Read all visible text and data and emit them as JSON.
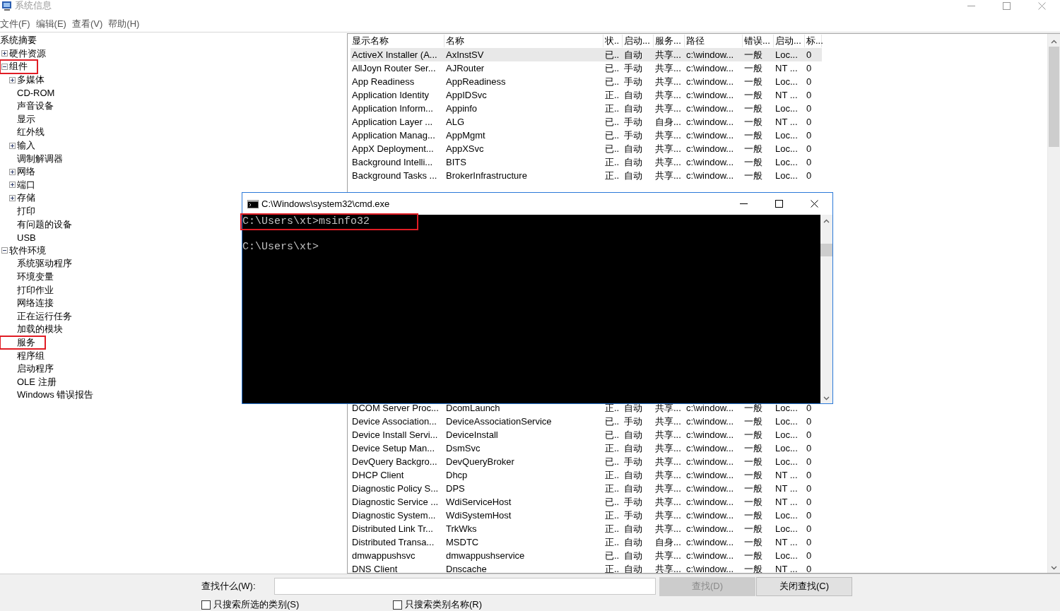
{
  "window": {
    "title": "系统信息"
  },
  "menu": [
    {
      "label": "文件(F)"
    },
    {
      "label": "编辑(E)"
    },
    {
      "label": "查看(V)"
    },
    {
      "label": "帮助(H)"
    }
  ],
  "tree": [
    {
      "label": "系统摘要",
      "highlighted": false,
      "children": [
        {
          "label": "硬件资源",
          "expanded": false,
          "highlighted": false
        },
        {
          "label": "组件",
          "expanded": true,
          "highlighted": true,
          "children": [
            {
              "label": "多媒体",
              "expanded": false,
              "highlighted": false
            },
            {
              "label": "CD-ROM",
              "highlighted": false
            },
            {
              "label": "声音设备",
              "highlighted": false
            },
            {
              "label": "显示",
              "highlighted": false
            },
            {
              "label": "红外线",
              "highlighted": false
            },
            {
              "label": "输入",
              "expanded": false,
              "highlighted": false
            },
            {
              "label": "调制解调器",
              "highlighted": false
            },
            {
              "label": "网络",
              "expanded": false,
              "highlighted": false
            },
            {
              "label": "端口",
              "expanded": false,
              "highlighted": false
            },
            {
              "label": "存储",
              "expanded": false,
              "highlighted": false
            },
            {
              "label": "打印",
              "highlighted": false
            },
            {
              "label": "有问题的设备",
              "highlighted": false
            },
            {
              "label": "USB",
              "highlighted": false
            }
          ]
        },
        {
          "label": "软件环境",
          "expanded": true,
          "highlighted": false,
          "children": [
            {
              "label": "系统驱动程序",
              "highlighted": false
            },
            {
              "label": "环境变量",
              "highlighted": false
            },
            {
              "label": "打印作业",
              "highlighted": false
            },
            {
              "label": "网络连接",
              "highlighted": false
            },
            {
              "label": "正在运行任务",
              "highlighted": false
            },
            {
              "label": "加载的模块",
              "highlighted": false
            },
            {
              "label": "服务",
              "highlighted": true
            },
            {
              "label": "程序组",
              "highlighted": false
            },
            {
              "label": "启动程序",
              "highlighted": false
            },
            {
              "label": "OLE 注册",
              "highlighted": false
            },
            {
              "label": "Windows 错误报告",
              "highlighted": false
            }
          ]
        }
      ]
    }
  ],
  "table": {
    "columns": [
      "显示名称",
      "名称",
      "状..",
      "启动...",
      "服务...",
      "路径",
      "错误...",
      "启动...",
      "标..."
    ],
    "rows": [
      {
        "selected": true,
        "cells": [
          "ActiveX Installer (A...",
          "AxInstSV",
          "已..",
          "自动",
          "共享...",
          "c:\\window...",
          "一般",
          "Loc...",
          "0"
        ]
      },
      {
        "selected": false,
        "cells": [
          "AllJoyn Router Ser...",
          "AJRouter",
          "已..",
          "手动",
          "共享...",
          "c:\\window...",
          "一般",
          "NT ...",
          "0"
        ]
      },
      {
        "selected": false,
        "cells": [
          "App Readiness",
          "AppReadiness",
          "已..",
          "手动",
          "共享...",
          "c:\\window...",
          "一般",
          "Loc...",
          "0"
        ]
      },
      {
        "selected": false,
        "cells": [
          "Application Identity",
          "AppIDSvc",
          "正..",
          "自动",
          "共享...",
          "c:\\window...",
          "一般",
          "NT ...",
          "0"
        ]
      },
      {
        "selected": false,
        "cells": [
          "Application Inform...",
          "Appinfo",
          "正..",
          "自动",
          "共享...",
          "c:\\window...",
          "一般",
          "Loc...",
          "0"
        ]
      },
      {
        "selected": false,
        "cells": [
          "Application Layer ...",
          "ALG",
          "已..",
          "手动",
          "自身...",
          "c:\\window...",
          "一般",
          "NT ...",
          "0"
        ]
      },
      {
        "selected": false,
        "cells": [
          "Application Manag...",
          "AppMgmt",
          "已..",
          "手动",
          "共享...",
          "c:\\window...",
          "一般",
          "Loc...",
          "0"
        ]
      },
      {
        "selected": false,
        "cells": [
          "AppX Deployment...",
          "AppXSvc",
          "已..",
          "自动",
          "共享...",
          "c:\\window...",
          "一般",
          "Loc...",
          "0"
        ]
      },
      {
        "selected": false,
        "cells": [
          "Background Intelli...",
          "BITS",
          "正..",
          "自动",
          "共享...",
          "c:\\window...",
          "一般",
          "Loc...",
          "0"
        ]
      },
      {
        "selected": false,
        "cells": [
          "Background Tasks ...",
          "BrokerInfrastructure",
          "正..",
          "自动",
          "共享...",
          "c:\\window...",
          "一般",
          "Loc...",
          "0"
        ]
      }
    ],
    "rows_below_window": [
      {
        "selected": false,
        "cells": [
          "DCOM Server Proc...",
          "DcomLaunch",
          "正..",
          "自动",
          "共享...",
          "c:\\window...",
          "一般",
          "Loc...",
          "0"
        ]
      },
      {
        "selected": false,
        "cells": [
          "Device Association...",
          "DeviceAssociationService",
          "已..",
          "手动",
          "共享...",
          "c:\\window...",
          "一般",
          "Loc...",
          "0"
        ]
      },
      {
        "selected": false,
        "cells": [
          "Device Install Servi...",
          "DeviceInstall",
          "已..",
          "自动",
          "共享...",
          "c:\\window...",
          "一般",
          "Loc...",
          "0"
        ]
      },
      {
        "selected": false,
        "cells": [
          "Device Setup Man...",
          "DsmSvc",
          "正..",
          "自动",
          "共享...",
          "c:\\window...",
          "一般",
          "Loc...",
          "0"
        ]
      },
      {
        "selected": false,
        "cells": [
          "DevQuery Backgro...",
          "DevQueryBroker",
          "已..",
          "手动",
          "共享...",
          "c:\\window...",
          "一般",
          "Loc...",
          "0"
        ]
      },
      {
        "selected": false,
        "cells": [
          "DHCP Client",
          "Dhcp",
          "正..",
          "自动",
          "共享...",
          "c:\\window...",
          "一般",
          "NT ...",
          "0"
        ]
      },
      {
        "selected": false,
        "cells": [
          "Diagnostic Policy S...",
          "DPS",
          "正..",
          "自动",
          "共享...",
          "c:\\window...",
          "一般",
          "NT ...",
          "0"
        ]
      },
      {
        "selected": false,
        "cells": [
          "Diagnostic Service ...",
          "WdiServiceHost",
          "已..",
          "手动",
          "共享...",
          "c:\\window...",
          "一般",
          "NT ...",
          "0"
        ]
      },
      {
        "selected": false,
        "cells": [
          "Diagnostic System...",
          "WdiSystemHost",
          "正..",
          "手动",
          "共享...",
          "c:\\window...",
          "一般",
          "Loc...",
          "0"
        ]
      },
      {
        "selected": false,
        "cells": [
          "Distributed Link Tr...",
          "TrkWks",
          "正..",
          "自动",
          "共享...",
          "c:\\window...",
          "一般",
          "Loc...",
          "0"
        ]
      },
      {
        "selected": false,
        "cells": [
          "Distributed Transa...",
          "MSDTC",
          "正..",
          "自动",
          "自身...",
          "c:\\window...",
          "一般",
          "NT ...",
          "0"
        ]
      },
      {
        "selected": false,
        "cells": [
          "dmwappushsvc",
          "dmwappushservice",
          "已..",
          "自动",
          "共享...",
          "c:\\window...",
          "一般",
          "Loc...",
          "0"
        ]
      },
      {
        "selected": false,
        "cells": [
          "DNS Client",
          "Dnscache",
          "正..",
          "自动",
          "共享...",
          "c:\\window...",
          "一般",
          "NT ...",
          "0"
        ]
      }
    ]
  },
  "find_bar": {
    "label": "查找什么(W):",
    "buttons": [
      {
        "label": "查找(D)",
        "disabled": true
      },
      {
        "label": "关闭查找(C)",
        "disabled": false
      }
    ],
    "checkboxes": [
      {
        "label": "只搜索所选的类别(S)",
        "checked": false
      },
      {
        "label": "只搜索类别名称(R)",
        "checked": false
      }
    ]
  },
  "console_window": {
    "title": "C:\\Windows\\system32\\cmd.exe",
    "lines": [
      {
        "text": "C:\\Users\\xt>msinfo32",
        "highlighted": true
      },
      {
        "text": "C:\\Users\\xt>",
        "highlighted": false
      }
    ]
  }
}
